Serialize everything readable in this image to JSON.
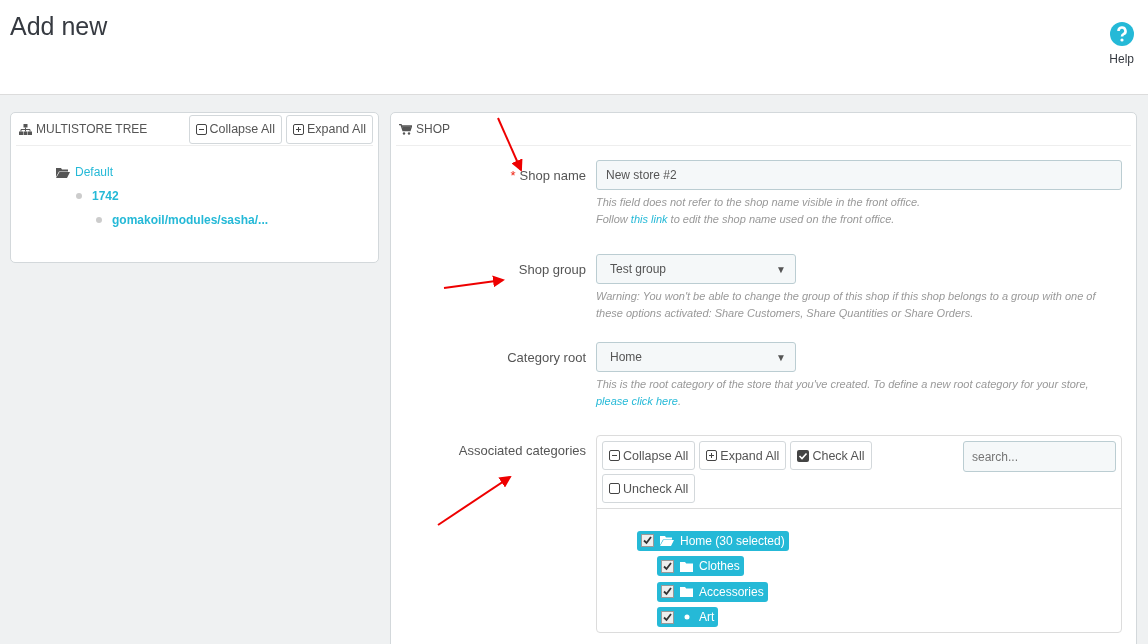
{
  "page": {
    "title": "Add new",
    "help_label": "Help"
  },
  "multistore_tree": {
    "title": "MULTISTORE TREE",
    "buttons": [
      {
        "kind": "collapse",
        "label": "Collapse All"
      },
      {
        "kind": "expand",
        "label": "Expand All"
      }
    ],
    "items": [
      {
        "label": "Default",
        "kind": "group",
        "children": [
          {
            "label": "1742",
            "kind": "shop",
            "children": [
              {
                "label": "gomakoil/modules/sasha/...",
                "kind": "shop"
              }
            ]
          }
        ]
      }
    ]
  },
  "shop_form": {
    "title": "SHOP",
    "shop_name": {
      "label": "Shop name",
      "required_mark": "*",
      "value": "New store #2",
      "help_before": "This field does not refer to the shop name visible in the front office.",
      "help_follow": "Follow",
      "help_link": "this link",
      "help_after": "to edit the shop name used on the front office."
    },
    "shop_group": {
      "label": "Shop group",
      "value": "Test group",
      "caret": "▼",
      "help": "Warning: You won't be able to change the group of this shop if this shop belongs to a group with one of these options activated: Share Customers, Share Quantities or Share Orders."
    },
    "category_root": {
      "label": "Category root",
      "value": "Home",
      "caret": "▼",
      "help": "This is the root category of the store that you've created. To define a new root category for your store,",
      "help_link": "please click here",
      "help_end": "."
    },
    "associated_categories": {
      "label": "Associated categories",
      "buttons": [
        {
          "kind": "collapse",
          "label": "Collapse All"
        },
        {
          "kind": "expand",
          "label": "Expand All"
        },
        {
          "kind": "check",
          "label": "Check All"
        },
        {
          "kind": "uncheck",
          "label": "Uncheck All"
        }
      ],
      "search_placeholder": "search...",
      "tree": [
        {
          "label": "Home (30 selected)",
          "kind": "folder-open",
          "checked": true,
          "children": [
            {
              "label": "Clothes",
              "kind": "folder",
              "checked": true
            },
            {
              "label": "Accessories",
              "kind": "folder",
              "checked": true
            },
            {
              "label": "Art",
              "kind": "leaf",
              "checked": true
            }
          ]
        }
      ]
    }
  }
}
